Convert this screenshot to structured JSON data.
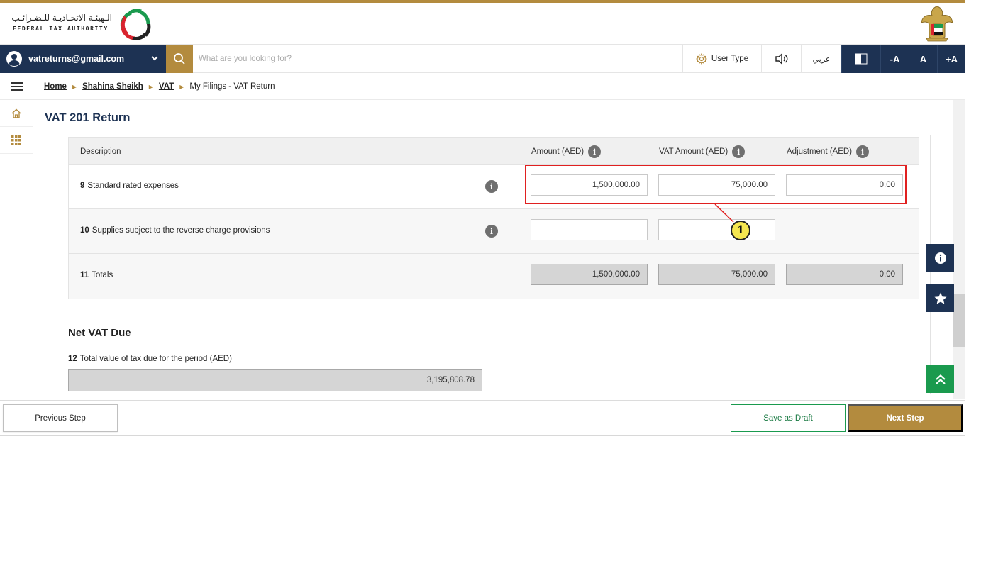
{
  "header": {
    "logo_arabic": "الـهيئـة الاتحـاديـة للـضـرائـب",
    "logo_english": "FEDERAL TAX AUTHORITY"
  },
  "nav": {
    "user_email": "vatreturns@gmail.com",
    "search_placeholder": "What are you looking for?",
    "user_type_label": "User Type",
    "arabic_label": "عربي",
    "font_decrease": "-A",
    "font_normal": "A",
    "font_increase": "+A"
  },
  "breadcrumb": {
    "items": [
      "Home",
      "Shahina Sheikh",
      "VAT"
    ],
    "current": "My Filings - VAT Return"
  },
  "page": {
    "title": "VAT 201 Return"
  },
  "table": {
    "headers": {
      "description": "Description",
      "amount": "Amount (AED)",
      "vat_amount": "VAT Amount (AED)",
      "adjustment": "Adjustment (AED)"
    },
    "rows": [
      {
        "num": "9",
        "label": "Standard rated expenses",
        "amount": "1,500,000.00",
        "vat": "75,000.00",
        "adjustment": "0.00"
      },
      {
        "num": "10",
        "label": "Supplies subject to the reverse charge provisions",
        "amount": "",
        "vat": ""
      },
      {
        "num": "11",
        "label": "Totals",
        "amount": "1,500,000.00",
        "vat": "75,000.00",
        "adjustment": "0.00"
      }
    ]
  },
  "net_vat": {
    "title": "Net VAT Due",
    "row_num": "12",
    "row_label": "Total value of tax due for the period (AED)",
    "value": "3,195,808.78"
  },
  "callout": {
    "label": "1"
  },
  "footer": {
    "previous": "Previous Step",
    "save_draft": "Save as Draft",
    "next": "Next Step"
  },
  "colors": {
    "navy": "#1d3253",
    "gold": "#b38b3e",
    "green": "#1a9a4e",
    "highlight_red": "#e02020",
    "callout_yellow": "#f5e64f"
  }
}
